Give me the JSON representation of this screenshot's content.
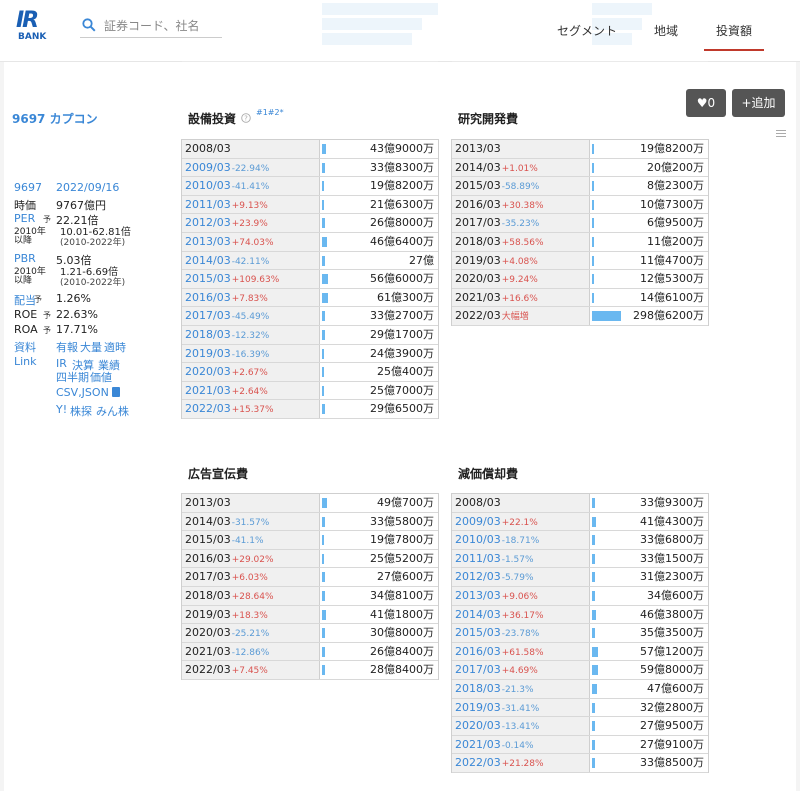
{
  "header": {
    "logo_top": "IR",
    "logo_bottom": "BANK",
    "search_placeholder": "証券コード、社名",
    "nav": [
      "セグメント",
      "地域",
      "投資額"
    ]
  },
  "actions": {
    "like_count": "♥0",
    "add_label": "+追加"
  },
  "company": {
    "title": "9697 カプコン",
    "code": "9697",
    "date": "2022/09/16",
    "rows": [
      {
        "k": "時価",
        "v": "9767億円"
      },
      {
        "k": "PER",
        "k_sub": "予",
        "v": "22.21倍"
      },
      {
        "k": "2010年以降",
        "v": "10.01-62.81倍",
        "v2": "(2010-2022年)"
      },
      {
        "k": "PBR",
        "v": "5.03倍"
      },
      {
        "k": "2010年以降",
        "v": "1.21-6.69倍",
        "v2": "(2010-2022年)"
      },
      {
        "k": "配当",
        "k_sub": "予",
        "v": "1.26%"
      },
      {
        "k": "ROE",
        "k_sub": "予",
        "v": "22.63%"
      },
      {
        "k": "ROA",
        "k_sub": "予",
        "v": "17.71%"
      }
    ],
    "docs_label": "資料",
    "docs_links": [
      "有報",
      "大量",
      "適時"
    ],
    "link_label": "Link",
    "link_row1": [
      "IR",
      "決算",
      "業績"
    ],
    "link_row2": [
      "四半期",
      "価値"
    ],
    "link_row3": "CSV,JSON",
    "link_row4": [
      "Y!",
      "株探",
      "みん株"
    ]
  },
  "sections": {
    "capex": {
      "title": "設備投資",
      "notes": "#1#2*",
      "rows": [
        {
          "year": "2008/03",
          "chg": "",
          "val": "43億9000万",
          "bar": 0.147
        },
        {
          "year": "2009/03",
          "chg": "-22.94%",
          "val": "33億8300万",
          "bar": 0.113
        },
        {
          "year": "2010/03",
          "chg": "-41.41%",
          "val": "19億8200万",
          "bar": 0.066
        },
        {
          "year": "2011/03",
          "chg": "+9.13%",
          "val": "21億6300万",
          "bar": 0.072
        },
        {
          "year": "2012/03",
          "chg": "+23.9%",
          "val": "26億8000万",
          "bar": 0.09
        },
        {
          "year": "2013/03",
          "chg": "+74.03%",
          "val": "46億6400万",
          "bar": 0.156
        },
        {
          "year": "2014/03",
          "chg": "-42.11%",
          "val": "27億",
          "bar": 0.09
        },
        {
          "year": "2015/03",
          "chg": "+109.63%",
          "val": "56億6000万",
          "bar": 0.19
        },
        {
          "year": "2016/03",
          "chg": "+7.83%",
          "val": "61億300万",
          "bar": 0.205
        },
        {
          "year": "2017/03",
          "chg": "-45.49%",
          "val": "33億2700万",
          "bar": 0.111
        },
        {
          "year": "2018/03",
          "chg": "-12.32%",
          "val": "29億1700万",
          "bar": 0.098
        },
        {
          "year": "2019/03",
          "chg": "-16.39%",
          "val": "24億3900万",
          "bar": 0.082
        },
        {
          "year": "2020/03",
          "chg": "+2.67%",
          "val": "25億400万",
          "bar": 0.084
        },
        {
          "year": "2021/03",
          "chg": "+2.64%",
          "val": "25億7000万",
          "bar": 0.086
        },
        {
          "year": "2022/03",
          "chg": "+15.37%",
          "val": "29億6500万",
          "bar": 0.099
        }
      ]
    },
    "rnd": {
      "title": "研究開発費",
      "rows": [
        {
          "year": "2013/03",
          "chg": "",
          "val": "19億8200万",
          "bar": 0.066
        },
        {
          "year": "2014/03",
          "chg": "+1.01%",
          "val": "20億200万",
          "bar": 0.067
        },
        {
          "year": "2015/03",
          "chg": "-58.89%",
          "val": "8億2300万",
          "bar": 0.028
        },
        {
          "year": "2016/03",
          "chg": "+30.38%",
          "val": "10億7300万",
          "bar": 0.036
        },
        {
          "year": "2017/03",
          "chg": "-35.23%",
          "val": "6億9500万",
          "bar": 0.023
        },
        {
          "year": "2018/03",
          "chg": "+58.56%",
          "val": "11億200万",
          "bar": 0.037
        },
        {
          "year": "2019/03",
          "chg": "+4.08%",
          "val": "11億4700万",
          "bar": 0.038
        },
        {
          "year": "2020/03",
          "chg": "+9.24%",
          "val": "12億5300万",
          "bar": 0.042
        },
        {
          "year": "2021/03",
          "chg": "+16.6%",
          "val": "14億6100万",
          "bar": 0.049
        },
        {
          "year": "2022/03",
          "chg": "大幅増",
          "val": "298億6200万",
          "bar": 1.0
        }
      ]
    },
    "ad": {
      "title": "広告宣伝費",
      "rows": [
        {
          "year": "2013/03",
          "chg": "",
          "val": "49億700万",
          "bar": 0.164
        },
        {
          "year": "2014/03",
          "chg": "-31.57%",
          "val": "33億5800万",
          "bar": 0.112
        },
        {
          "year": "2015/03",
          "chg": "-41.1%",
          "val": "19億7800万",
          "bar": 0.066
        },
        {
          "year": "2016/03",
          "chg": "+29.02%",
          "val": "25億5200万",
          "bar": 0.085
        },
        {
          "year": "2017/03",
          "chg": "+6.03%",
          "val": "27億600万",
          "bar": 0.091
        },
        {
          "year": "2018/03",
          "chg": "+28.64%",
          "val": "34億8100万",
          "bar": 0.117
        },
        {
          "year": "2019/03",
          "chg": "+18.3%",
          "val": "41億1800万",
          "bar": 0.138
        },
        {
          "year": "2020/03",
          "chg": "-25.21%",
          "val": "30億8000万",
          "bar": 0.103
        },
        {
          "year": "2021/03",
          "chg": "-12.86%",
          "val": "26億8400万",
          "bar": 0.09
        },
        {
          "year": "2022/03",
          "chg": "+7.45%",
          "val": "28億8400万",
          "bar": 0.097
        }
      ]
    },
    "dep": {
      "title": "減価償却費",
      "rows": [
        {
          "year": "2008/03",
          "chg": "",
          "val": "33億9300万",
          "bar": 0.114
        },
        {
          "year": "2009/03",
          "chg": "+22.1%",
          "val": "41億4300万",
          "bar": 0.139
        },
        {
          "year": "2010/03",
          "chg": "-18.71%",
          "val": "33億6800万",
          "bar": 0.113
        },
        {
          "year": "2011/03",
          "chg": "-1.57%",
          "val": "33億1500万",
          "bar": 0.111
        },
        {
          "year": "2012/03",
          "chg": "-5.79%",
          "val": "31億2300万",
          "bar": 0.105
        },
        {
          "year": "2013/03",
          "chg": "+9.06%",
          "val": "34億600万",
          "bar": 0.114
        },
        {
          "year": "2014/03",
          "chg": "+36.17%",
          "val": "46億3800万",
          "bar": 0.155
        },
        {
          "year": "2015/03",
          "chg": "-23.78%",
          "val": "35億3500万",
          "bar": 0.118
        },
        {
          "year": "2016/03",
          "chg": "+61.58%",
          "val": "57億1200万",
          "bar": 0.191
        },
        {
          "year": "2017/03",
          "chg": "+4.69%",
          "val": "59億8000万",
          "bar": 0.2
        },
        {
          "year": "2018/03",
          "chg": "-21.3%",
          "val": "47億600万",
          "bar": 0.158
        },
        {
          "year": "2019/03",
          "chg": "-31.41%",
          "val": "32億2800万",
          "bar": 0.108
        },
        {
          "year": "2020/03",
          "chg": "-13.41%",
          "val": "27億9500万",
          "bar": 0.094
        },
        {
          "year": "2021/03",
          "chg": "-0.14%",
          "val": "27億9100万",
          "bar": 0.093
        },
        {
          "year": "2022/03",
          "chg": "+21.28%",
          "val": "33億8500万",
          "bar": 0.113
        }
      ]
    }
  }
}
